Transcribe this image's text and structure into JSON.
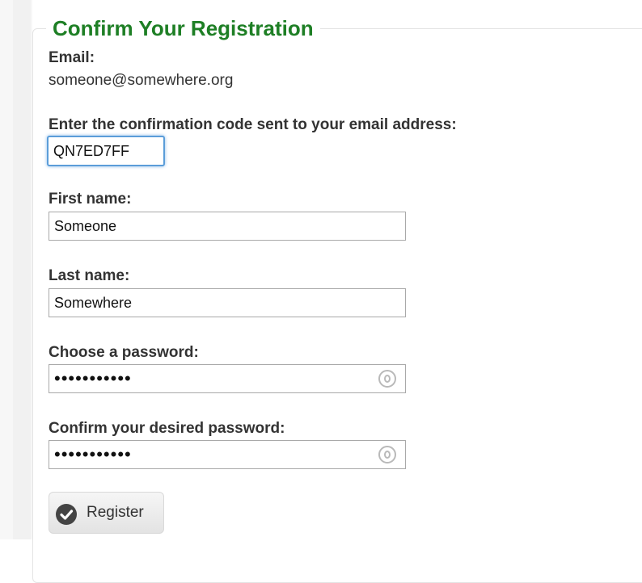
{
  "form": {
    "title": "Confirm Your Registration",
    "email_label": "Email:",
    "email_value": "someone@somewhere.org",
    "code_label": "Enter the confirmation code sent to your email address:",
    "code_value": "QN7ED7FF",
    "first_name_label": "First name:",
    "first_name_value": "Someone",
    "last_name_label": "Last name:",
    "last_name_value": "Somewhere",
    "password_label": "Choose a password:",
    "password_value": "•••••••••••",
    "confirm_password_label": "Confirm your desired password:",
    "confirm_password_value": "•••••••••••",
    "register_label": "Register"
  },
  "icons": {
    "password_manager": "key-icon",
    "register": "check-circle-icon"
  },
  "colors": {
    "title": "#1e7f25",
    "focus_border": "#5b9dd9"
  }
}
